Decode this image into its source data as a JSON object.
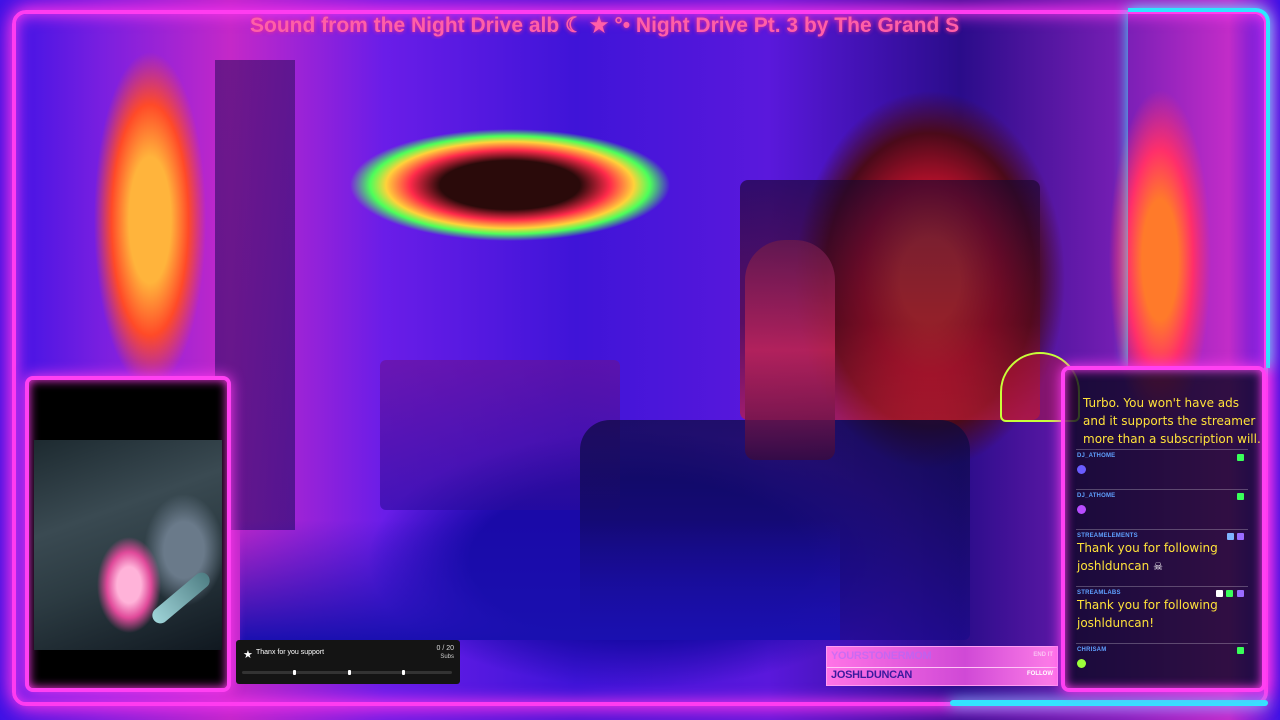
{
  "ticker": {
    "text": "Sound from the Night Drive alb ☾ ★ °• Night Drive Pt. 3 by The Grand S"
  },
  "sub_goal": {
    "label": "Thanx for you support",
    "count": "0 / 20",
    "unit": "Subs",
    "progress_fraction": 0,
    "star_icon": "star-icon"
  },
  "recent_events": [
    {
      "name": "YOURSTONERMOM",
      "type": "END IT"
    },
    {
      "name": "JOSHLDUNCAN",
      "type": "FOLLOW"
    }
  ],
  "chat": {
    "intro_text": "Turbo. You won't have ads and it supports the streamer more than a subscription will.",
    "messages": [
      {
        "user": "DJ_ATHOME",
        "text": "",
        "emote": "emote-icon"
      },
      {
        "user": "DJ_ATHOME",
        "text": "",
        "emote": "emote-icon"
      },
      {
        "user": "STREAMELEMENTS",
        "text": "Thank you for following joshlduncan",
        "emote": "skull-icon"
      },
      {
        "user": "STREAMLABS",
        "text": "Thank you for following joshlduncan!"
      },
      {
        "user": "CHRISAM",
        "text": "",
        "emote": "emote-icon"
      }
    ]
  },
  "colors": {
    "neon_pink": "#ff3cf0",
    "neon_cyan": "#2ee6ff",
    "chat_text": "#ffe23a",
    "chat_user": "#5fa0ff",
    "badge_green": "#39ff5a"
  }
}
